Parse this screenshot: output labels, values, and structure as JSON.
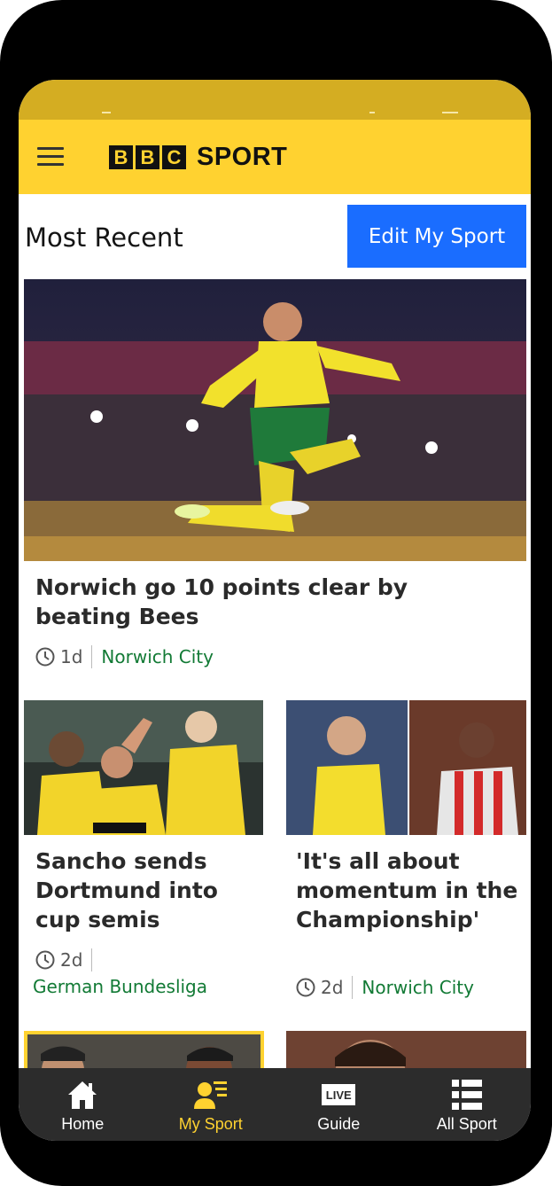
{
  "header": {
    "logo_letters": [
      "B",
      "B",
      "C"
    ],
    "logo_word": "SPORT"
  },
  "section": {
    "title": "Most Recent",
    "edit_button": "Edit My Sport"
  },
  "articles": [
    {
      "headline": "Norwich go 10 points clear by beating Bees",
      "age": "1d",
      "topic": "Norwich City"
    },
    {
      "headline": "Sancho sends Dortmund into cup semis",
      "age": "2d",
      "topic": "German Bundesliga"
    },
    {
      "headline": "'It's all about momentum in the Championship'",
      "age": "2d",
      "topic": "Norwich City"
    }
  ],
  "nav": {
    "items": [
      {
        "label": "Home",
        "icon": "home-icon"
      },
      {
        "label": "My Sport",
        "icon": "my-sport-icon",
        "active": true
      },
      {
        "label": "Guide",
        "icon": "live-guide-icon",
        "badge": "LIVE"
      },
      {
        "label": "All Sport",
        "icon": "list-icon"
      }
    ]
  },
  "colors": {
    "brand_yellow": "#ffd230",
    "accent_blue": "#1a6dff",
    "topic_green": "#127a35",
    "nav_bg": "#2c2c2c"
  }
}
